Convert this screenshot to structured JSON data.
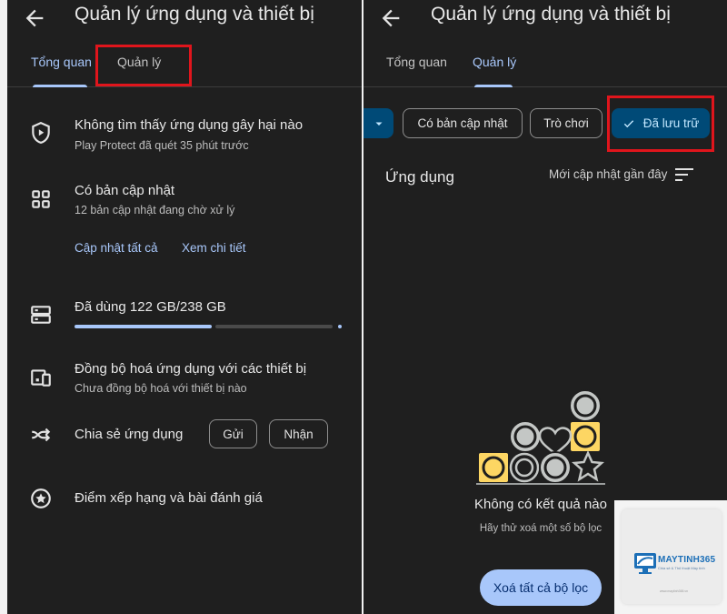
{
  "left_panel": {
    "title": "Quản lý ứng dụng và thiết bị",
    "tabs": [
      {
        "label": "Tổng quan",
        "active": true
      },
      {
        "label": "Quản lý",
        "active": false
      }
    ],
    "protect": {
      "title": "Không tìm thấy ứng dụng gây hại nào",
      "subtitle": "Play Protect đã quét 35 phút trước",
      "icon": "shield-play-icon"
    },
    "updates": {
      "title": "Có bản cập nhật",
      "subtitle": "12 bản cập nhật đang chờ xử lý",
      "icon": "apps-grid-icon",
      "update_all": "Cập nhật tất cả",
      "see_details": "Xem chi tiết"
    },
    "storage": {
      "title": "Đã dùng 122 GB/238 GB",
      "used_fraction": 0.513,
      "icon": "storage-icon"
    },
    "sync": {
      "title": "Đồng bộ hoá ứng dụng với các thiết bị",
      "subtitle": "Chưa đồng bộ hoá với thiết bị nào",
      "icon": "devices-icon"
    },
    "share": {
      "title": "Chia sẻ ứng dụng",
      "send": "Gửi",
      "receive": "Nhận",
      "icon": "share-arrows-icon"
    },
    "ratings": {
      "title": "Điểm xếp hạng và bài đánh giá",
      "icon": "star-circle-icon"
    }
  },
  "right_panel": {
    "title": "Quản lý ứng dụng và thiết bị",
    "tabs": [
      {
        "label": "Tổng quan",
        "active": false
      },
      {
        "label": "Quản lý",
        "active": true
      }
    ],
    "filters": {
      "updates": "Có bản cập nhật",
      "games": "Trò chơi",
      "archived": "Đã lưu trữ",
      "archived_selected": true
    },
    "section_title": "Ứng dụng",
    "sort_label": "Mới cập nhật gần đây",
    "empty": {
      "title": "Không có kết quả nào",
      "subtitle": "Hãy thử xoá một số bộ lọc",
      "clear_button": "Xoá tất cả bộ lọc"
    }
  },
  "watermark": {
    "brand": "MAYTINH365",
    "tagline": "Chia sẻ & Thủ thuật Máy tính",
    "url": "www.maytinh365.vn"
  },
  "colors": {
    "background": "#1f1f1f",
    "accent": "#a8c7fa",
    "selected_chip": "#004a77",
    "highlight_box": "#e0151c",
    "illustration_yellow": "#fdd663",
    "illustration_gray": "#c4c7c5"
  }
}
